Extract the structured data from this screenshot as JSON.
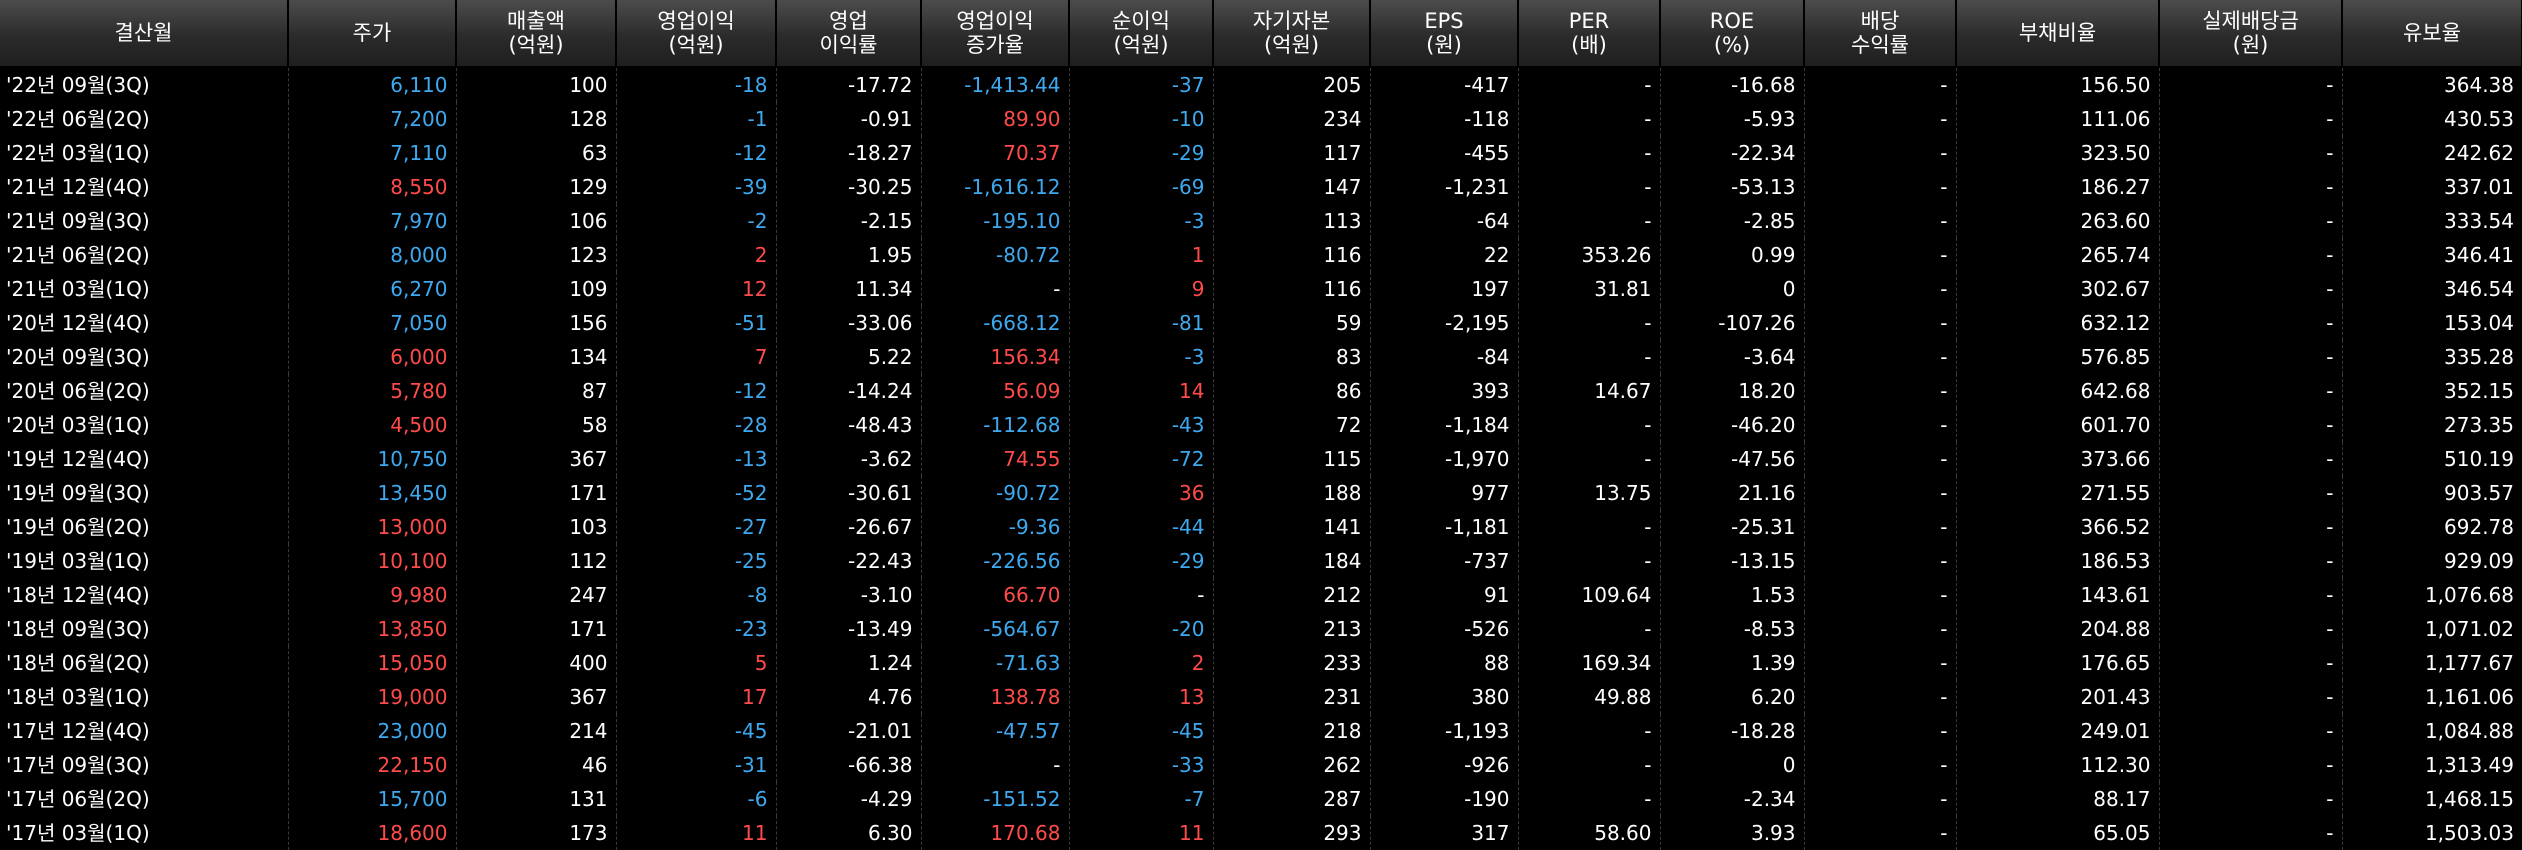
{
  "colors": {
    "up": "#ff4b4b",
    "down": "#3fa9ef",
    "flat": "#ffffff"
  },
  "headers": [
    [
      "결산월",
      ""
    ],
    [
      "주가",
      ""
    ],
    [
      "매출액",
      "(억원)"
    ],
    [
      "영업이익",
      "(억원)"
    ],
    [
      "영업",
      "이익률"
    ],
    [
      "영업이익",
      "증가율"
    ],
    [
      "순이익",
      "(억원)"
    ],
    [
      "자기자본",
      "(억원)"
    ],
    [
      "EPS",
      "(원)"
    ],
    [
      "PER",
      "(배)"
    ],
    [
      "ROE",
      "(%)"
    ],
    [
      "배당",
      "수익률"
    ],
    [
      "부채비율",
      ""
    ],
    [
      "실제배당금",
      "(원)"
    ],
    [
      "유보율",
      ""
    ]
  ],
  "colorized_columns": [
    1,
    3,
    5,
    6
  ],
  "rows": [
    [
      "'22년 09월(3Q)",
      "6,110",
      "100",
      "-18",
      "-17.72",
      "-1,413.44",
      "-37",
      "205",
      "-417",
      "-",
      "-16.68",
      "-",
      "156.50",
      "-",
      "364.38"
    ],
    [
      "'22년 06월(2Q)",
      "7,200",
      "128",
      "-1",
      "-0.91",
      "89.90",
      "-10",
      "234",
      "-118",
      "-",
      "-5.93",
      "-",
      "111.06",
      "-",
      "430.53"
    ],
    [
      "'22년 03월(1Q)",
      "7,110",
      "63",
      "-12",
      "-18.27",
      "70.37",
      "-29",
      "117",
      "-455",
      "-",
      "-22.34",
      "-",
      "323.50",
      "-",
      "242.62"
    ],
    [
      "'21년 12월(4Q)",
      "8,550",
      "129",
      "-39",
      "-30.25",
      "-1,616.12",
      "-69",
      "147",
      "-1,231",
      "-",
      "-53.13",
      "-",
      "186.27",
      "-",
      "337.01"
    ],
    [
      "'21년 09월(3Q)",
      "7,970",
      "106",
      "-2",
      "-2.15",
      "-195.10",
      "-3",
      "113",
      "-64",
      "-",
      "-2.85",
      "-",
      "263.60",
      "-",
      "333.54"
    ],
    [
      "'21년 06월(2Q)",
      "8,000",
      "123",
      "2",
      "1.95",
      "-80.72",
      "1",
      "116",
      "22",
      "353.26",
      "0.99",
      "-",
      "265.74",
      "-",
      "346.41"
    ],
    [
      "'21년 03월(1Q)",
      "6,270",
      "109",
      "12",
      "11.34",
      "-",
      "9",
      "116",
      "197",
      "31.81",
      "0",
      "-",
      "302.67",
      "-",
      "346.54"
    ],
    [
      "'20년 12월(4Q)",
      "7,050",
      "156",
      "-51",
      "-33.06",
      "-668.12",
      "-81",
      "59",
      "-2,195",
      "-",
      "-107.26",
      "-",
      "632.12",
      "-",
      "153.04"
    ],
    [
      "'20년 09월(3Q)",
      "6,000",
      "134",
      "7",
      "5.22",
      "156.34",
      "-3",
      "83",
      "-84",
      "-",
      "-3.64",
      "-",
      "576.85",
      "-",
      "335.28"
    ],
    [
      "'20년 06월(2Q)",
      "5,780",
      "87",
      "-12",
      "-14.24",
      "56.09",
      "14",
      "86",
      "393",
      "14.67",
      "18.20",
      "-",
      "642.68",
      "-",
      "352.15"
    ],
    [
      "'20년 03월(1Q)",
      "4,500",
      "58",
      "-28",
      "-48.43",
      "-112.68",
      "-43",
      "72",
      "-1,184",
      "-",
      "-46.20",
      "-",
      "601.70",
      "-",
      "273.35"
    ],
    [
      "'19년 12월(4Q)",
      "10,750",
      "367",
      "-13",
      "-3.62",
      "74.55",
      "-72",
      "115",
      "-1,970",
      "-",
      "-47.56",
      "-",
      "373.66",
      "-",
      "510.19"
    ],
    [
      "'19년 09월(3Q)",
      "13,450",
      "171",
      "-52",
      "-30.61",
      "-90.72",
      "36",
      "188",
      "977",
      "13.75",
      "21.16",
      "-",
      "271.55",
      "-",
      "903.57"
    ],
    [
      "'19년 06월(2Q)",
      "13,000",
      "103",
      "-27",
      "-26.67",
      "-9.36",
      "-44",
      "141",
      "-1,181",
      "-",
      "-25.31",
      "-",
      "366.52",
      "-",
      "692.78"
    ],
    [
      "'19년 03월(1Q)",
      "10,100",
      "112",
      "-25",
      "-22.43",
      "-226.56",
      "-29",
      "184",
      "-737",
      "-",
      "-13.15",
      "-",
      "186.53",
      "-",
      "929.09"
    ],
    [
      "'18년 12월(4Q)",
      "9,980",
      "247",
      "-8",
      "-3.10",
      "66.70",
      "-",
      "212",
      "91",
      "109.64",
      "1.53",
      "-",
      "143.61",
      "-",
      "1,076.68"
    ],
    [
      "'18년 09월(3Q)",
      "13,850",
      "171",
      "-23",
      "-13.49",
      "-564.67",
      "-20",
      "213",
      "-526",
      "-",
      "-8.53",
      "-",
      "204.88",
      "-",
      "1,071.02"
    ],
    [
      "'18년 06월(2Q)",
      "15,050",
      "400",
      "5",
      "1.24",
      "-71.63",
      "2",
      "233",
      "88",
      "169.34",
      "1.39",
      "-",
      "176.65",
      "-",
      "1,177.67"
    ],
    [
      "'18년 03월(1Q)",
      "19,000",
      "367",
      "17",
      "4.76",
      "138.78",
      "13",
      "231",
      "380",
      "49.88",
      "6.20",
      "-",
      "201.43",
      "-",
      "1,161.06"
    ],
    [
      "'17년 12월(4Q)",
      "23,000",
      "214",
      "-45",
      "-21.01",
      "-47.57",
      "-45",
      "218",
      "-1,193",
      "-",
      "-18.28",
      "-",
      "249.01",
      "-",
      "1,084.88"
    ],
    [
      "'17년 09월(3Q)",
      "22,150",
      "46",
      "-31",
      "-66.38",
      "-",
      "-33",
      "262",
      "-926",
      "-",
      "0",
      "-",
      "112.30",
      "-",
      "1,313.49"
    ],
    [
      "'17년 06월(2Q)",
      "15,700",
      "131",
      "-6",
      "-4.29",
      "-151.52",
      "-7",
      "287",
      "-190",
      "-",
      "-2.34",
      "-",
      "88.17",
      "-",
      "1,468.15"
    ],
    [
      "'17년 03월(1Q)",
      "18,600",
      "173",
      "11",
      "6.30",
      "170.68",
      "11",
      "293",
      "317",
      "58.60",
      "3.93",
      "-",
      "65.05",
      "-",
      "1,503.03"
    ]
  ],
  "price_direction": [
    "down",
    "down",
    "down",
    "up",
    "down",
    "down",
    "down",
    "down",
    "up",
    "up",
    "up",
    "down",
    "down",
    "up",
    "up",
    "up",
    "up",
    "up",
    "up",
    "down",
    "up",
    "down",
    "up"
  ]
}
